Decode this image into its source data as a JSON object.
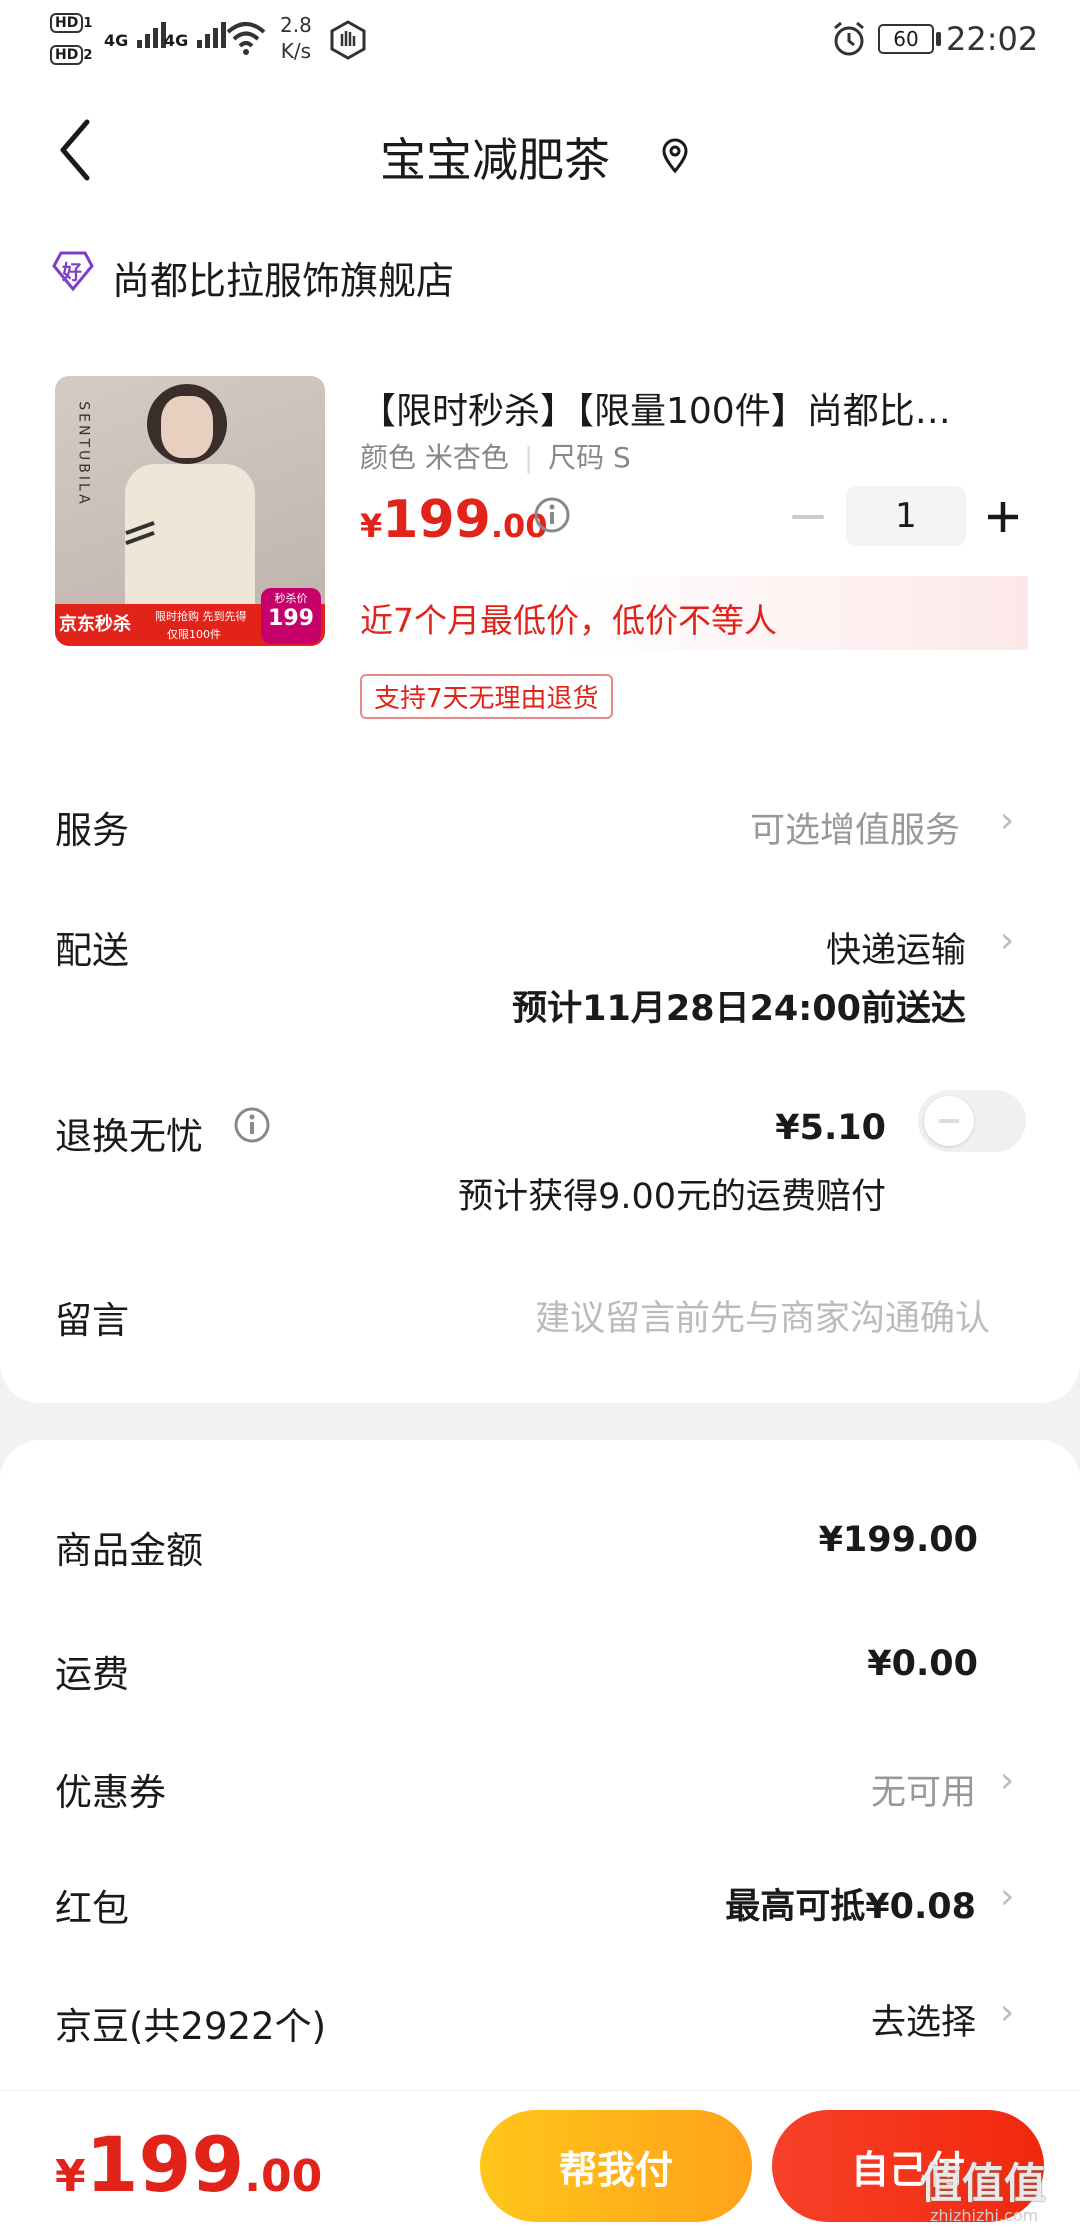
{
  "status_bar": {
    "net_speed_value": "2.8",
    "net_speed_unit": "K/s",
    "signal_1": "4G",
    "signal_2": "4G",
    "battery": "60",
    "time": "22:02"
  },
  "header": {
    "title": "宝宝减肥茶"
  },
  "store": {
    "badge": "好",
    "name": "尚都比拉服饰旗舰店"
  },
  "product": {
    "image_brand": "SENTUBILA",
    "image_tag": "京东秒杀",
    "image_promo": "限时抢购 先到先得",
    "image_limit": "仅限100件",
    "image_price_label": "秒杀价",
    "image_price": "199",
    "title": "【限时秒杀】【限量100件】尚都比…",
    "spec_color": "颜色 米杏色",
    "spec_size": "尺码 S",
    "price_symbol": "¥",
    "price_int": "199",
    "price_dec": ".00",
    "quantity": "1",
    "low_price_note": "近7个月最低价，低价不等人",
    "return_tag": "支持7天无理由退货"
  },
  "rows": {
    "service_label": "服务",
    "service_value": "可选增值服务",
    "delivery_label": "配送",
    "delivery_value": "快递运输",
    "delivery_eta": "预计11月28日24:00前送达",
    "worry_free_label": "退换无忧",
    "worry_free_price": "¥5.10",
    "worry_free_note": "预计获得9.00元的运费赔付",
    "message_label": "留言",
    "message_placeholder": "建议留言前先与商家沟通确认"
  },
  "summary": {
    "goods_label": "商品金额",
    "goods_value": "¥199.00",
    "shipping_label": "运费",
    "shipping_value": "¥0.00",
    "coupon_label": "优惠券",
    "coupon_value": "无可用",
    "redpacket_label": "红包",
    "redpacket_value": "最高可抵¥0.08",
    "jingdou_label": "京豆(共2922个)",
    "jingdou_value": "去选择"
  },
  "footer": {
    "total_symbol": "¥",
    "total_int": "199",
    "total_dec": ".00",
    "help_pay": "帮我付",
    "self_pay": "自己付",
    "watermark": "值值值",
    "watermark_url": "zhizhizhi.com"
  },
  "colors": {
    "accent_red": "#e2231a",
    "help_pay_start": "#ffc61a",
    "help_pay_end": "#ffa21a",
    "self_pay_start": "#f7412a",
    "self_pay_end": "#f2270c"
  }
}
